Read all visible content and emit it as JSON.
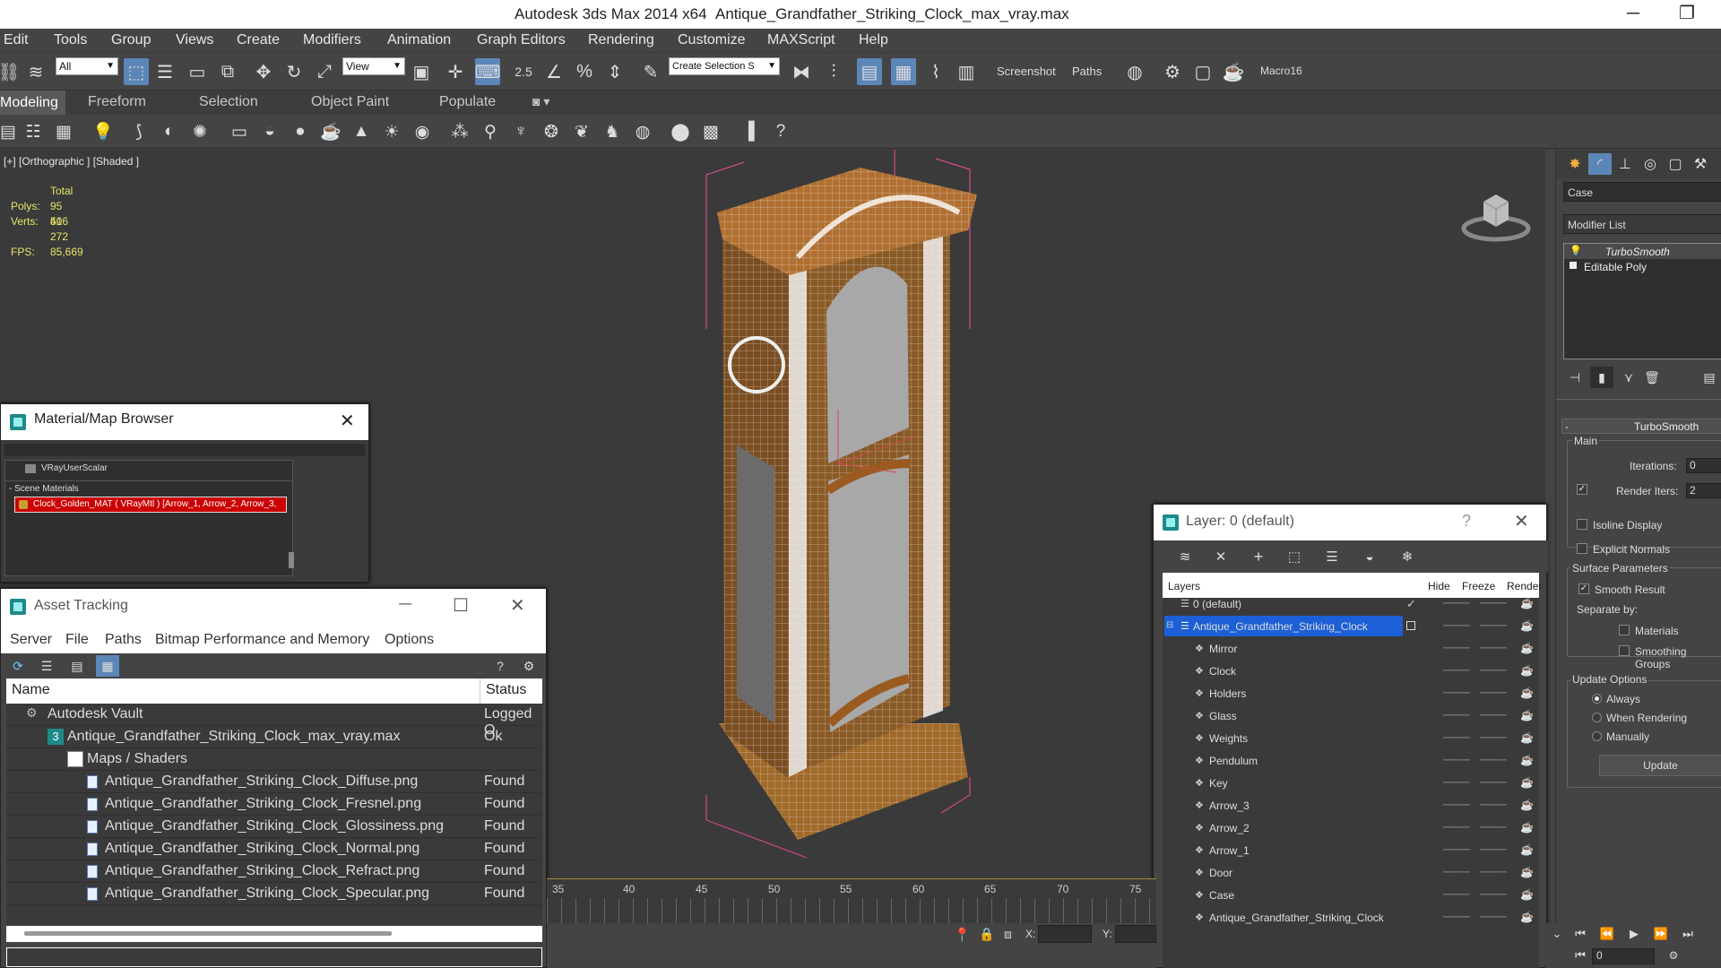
{
  "title": {
    "app": "Autodesk 3ds Max  2014 x64",
    "file": "Antique_Grandfather_Striking_Clock_max_vray.max"
  },
  "window_controls": {
    "minimize": "─",
    "restore": "❐"
  },
  "menu": [
    "Edit",
    "Tools",
    "Group",
    "Views",
    "Create",
    "Modifiers",
    "Animation",
    "Graph Editors",
    "Rendering",
    "Customize",
    "MAXScript",
    "Help"
  ],
  "toolbar": {
    "filter_value": "All",
    "refcoord_value": "View",
    "snap_label": "2.5",
    "named_selection_placeholder": "Create Selection S",
    "screenshot_label": "Screenshot",
    "paths_label": "Paths",
    "macro_label": "Macro16"
  },
  "ribbon_tabs": [
    "Modeling",
    "Freeform",
    "Selection",
    "Object Paint",
    "Populate"
  ],
  "viewport": {
    "label": "[+] [Orthographic ] [Shaded ]",
    "stats": {
      "total": "Total",
      "polys_label": "Polys:",
      "polys": "95 406",
      "verts_label": "Verts:",
      "verts": "51 272",
      "fps_label": "FPS:",
      "fps": "85,669"
    }
  },
  "material_browser": {
    "title": "Material/Map Browser",
    "item1": "VRayUserScalar",
    "group": "- Scene Materials",
    "selected": "Clock_Golden_MAT ( VRayMtl ) [Arrow_1, Arrow_2, Arrow_3,"
  },
  "asset_tracking": {
    "title": "Asset Tracking",
    "menu": [
      "Server",
      "File",
      "Paths",
      "Bitmap Performance and Memory",
      "Options"
    ],
    "col_name": "Name",
    "col_status": "Status",
    "rows": [
      {
        "name": "Autodesk Vault",
        "status": "Logged O"
      },
      {
        "name": "Antique_Grandfather_Striking_Clock_max_vray.max",
        "status": "Ok"
      },
      {
        "name": "Maps / Shaders",
        "status": ""
      },
      {
        "name": "Antique_Grandfather_Striking_Clock_Diffuse.png",
        "status": "Found"
      },
      {
        "name": "Antique_Grandfather_Striking_Clock_Fresnel.png",
        "status": "Found"
      },
      {
        "name": "Antique_Grandfather_Striking_Clock_Glossiness.png",
        "status": "Found"
      },
      {
        "name": "Antique_Grandfather_Striking_Clock_Normal.png",
        "status": "Found"
      },
      {
        "name": "Antique_Grandfather_Striking_Clock_Refract.png",
        "status": "Found"
      },
      {
        "name": "Antique_Grandfather_Striking_Clock_Specular.png",
        "status": "Found"
      }
    ]
  },
  "layer_dialog": {
    "title": "Layer: 0 (default)",
    "help": "?",
    "col_layers": "Layers",
    "col_hide": "Hide",
    "col_freeze": "Freeze",
    "col_render": "Render",
    "rows": [
      {
        "name": "0 (default)"
      },
      {
        "name": "Antique_Grandfather_Striking_Clock"
      },
      {
        "name": "Mirror"
      },
      {
        "name": "Clock"
      },
      {
        "name": "Holders"
      },
      {
        "name": "Glass"
      },
      {
        "name": "Weights"
      },
      {
        "name": "Pendulum"
      },
      {
        "name": "Key"
      },
      {
        "name": "Arrow_3"
      },
      {
        "name": "Arrow_2"
      },
      {
        "name": "Arrow_1"
      },
      {
        "name": "Door"
      },
      {
        "name": "Case"
      },
      {
        "name": "Antique_Grandfather_Striking_Clock"
      }
    ]
  },
  "command_panel": {
    "object_name": "Case",
    "modifier_list": "Modifier List",
    "stack": [
      "TurboSmooth",
      "Editable Poly"
    ],
    "rollout": "TurboSmooth",
    "main": "Main",
    "iterations_label": "Iterations:",
    "iterations": "0",
    "render_iters_label": "Render Iters:",
    "render_iters": "2",
    "isoline": "Isoline Display",
    "explicit": "Explicit Normals",
    "surface": "Surface Parameters",
    "smooth_result": "Smooth Result",
    "separate_by": "Separate by:",
    "materials": "Materials",
    "smoothing_groups": "Smoothing Groups",
    "update_options": "Update Options",
    "always": "Always",
    "when_rendering": "When Rendering",
    "manually": "Manually",
    "update_button": "Update"
  },
  "timeline": {
    "ticks": [
      "35",
      "40",
      "45",
      "50",
      "55",
      "60",
      "65",
      "70",
      "75"
    ]
  },
  "status": {
    "x_label": "X:",
    "y_label": "Y:",
    "frame": "0"
  }
}
